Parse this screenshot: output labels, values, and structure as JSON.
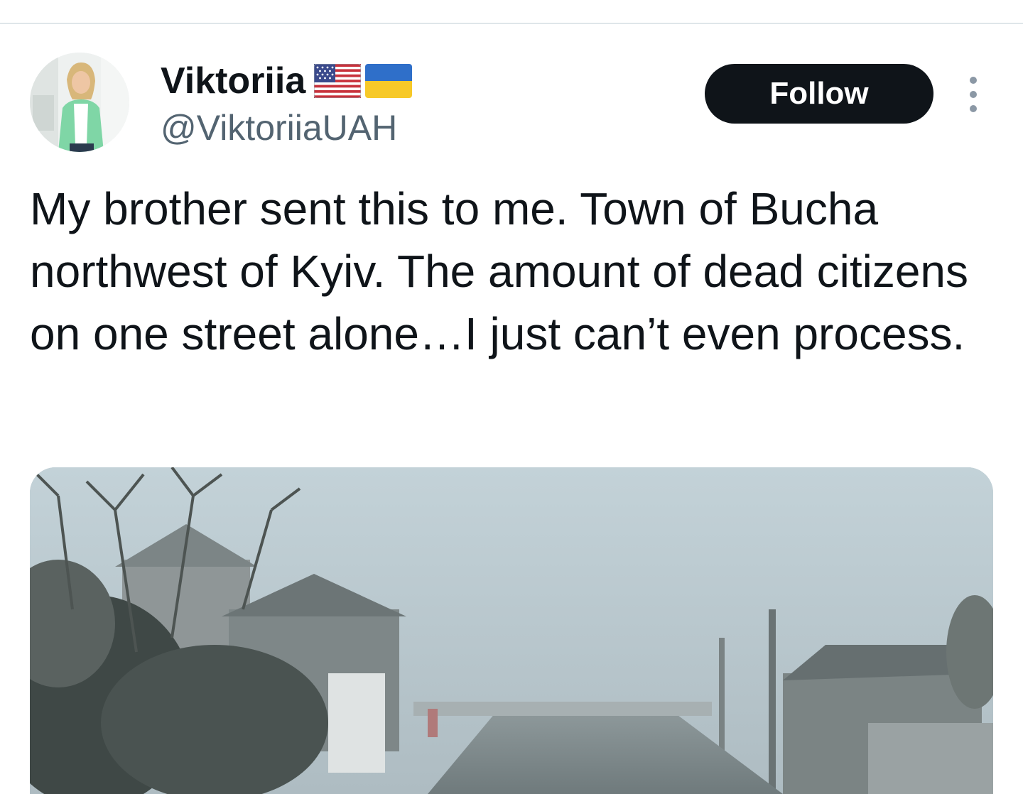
{
  "tweet": {
    "author": {
      "display_name": "Viktoriia",
      "handle": "@ViktoriiaUAH",
      "flags": [
        "us-flag-icon",
        "ukraine-flag-icon"
      ]
    },
    "follow_label": "Follow",
    "text": "My brother sent this to me. Town of Bucha northwest of Kyiv. The amount of dead citizens on one street alone…I just can’t even process.",
    "media": {
      "type": "photo"
    }
  },
  "colors": {
    "text_primary": "#0f1419",
    "text_secondary": "#536471",
    "button_bg": "#0f1419",
    "button_text": "#ffffff",
    "divider": "#dfe6ea"
  }
}
